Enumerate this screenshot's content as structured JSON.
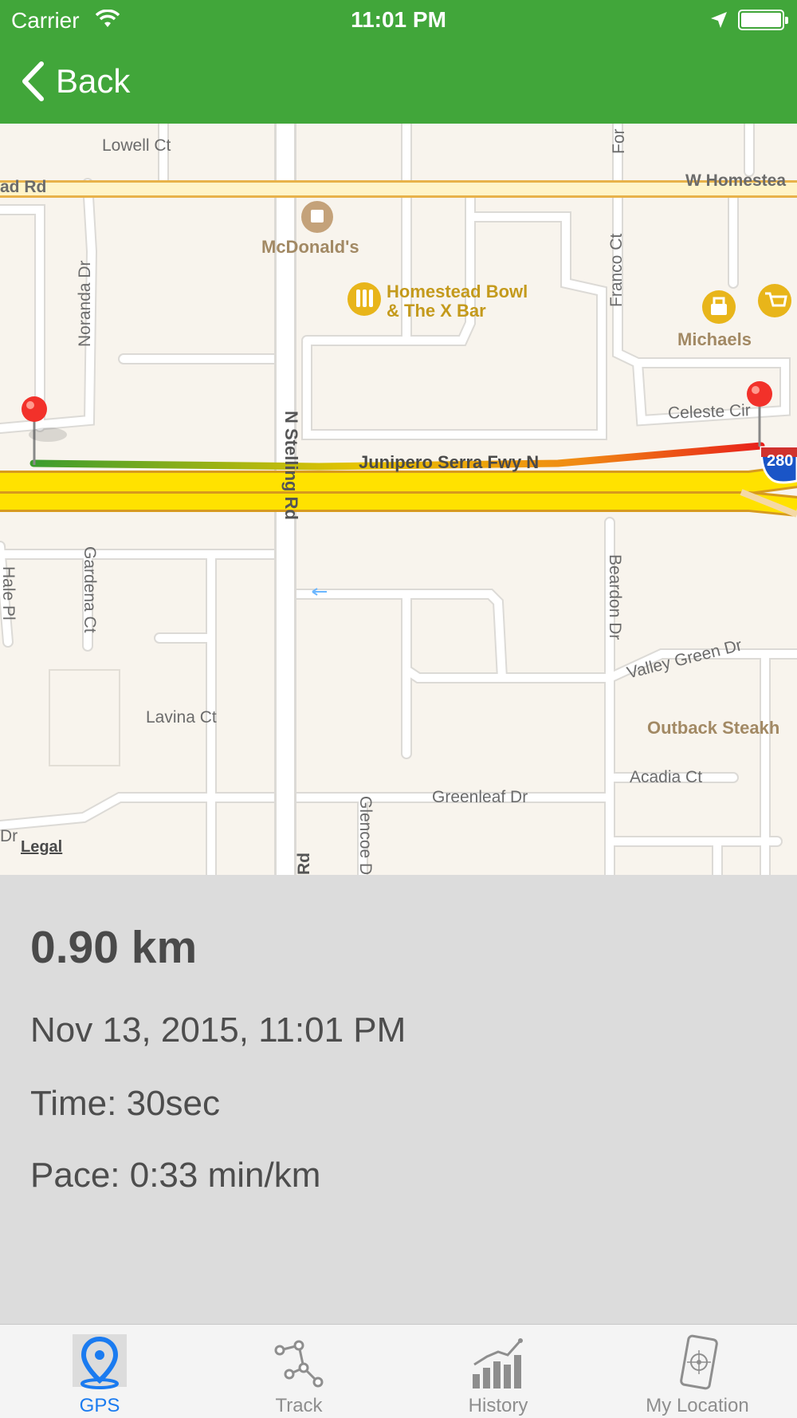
{
  "status_bar": {
    "carrier": "Carrier",
    "time": "11:01 PM"
  },
  "nav": {
    "back_label": "Back"
  },
  "map": {
    "street_labels": {
      "lowell": "Lowell Ct",
      "homestead_left": "ad Rd",
      "homestead_right": "W Homestea",
      "noranda": "Noranda Dr",
      "stelling": "N Stelling Rd",
      "franco": "Franco Ct",
      "celeste": "Celeste Cir",
      "freeway": "Junipero Serra Fwy N",
      "gardena": "Gardena Ct",
      "hale": "Hale Pl",
      "beardon": "Beardon Dr",
      "valley_green": "Valley Green Dr",
      "lavina": "Lavina Ct",
      "acadia": "Acadia Ct",
      "greenleaf": "Greenleaf Dr",
      "glencoe": "Glencoe Dr",
      "rd_bottom": "Rd",
      "dr_left": "Dr",
      "for": "For"
    },
    "pois": {
      "mcdonalds": "McDonald's",
      "homestead_bowl_1": "Homestead Bowl",
      "homestead_bowl_2": "& The X Bar",
      "michaels": "Michaels",
      "outback": "Outback Steakh"
    },
    "highway_shield": "280",
    "legal": "Legal",
    "route_colors": {
      "start": "#3b9c2e",
      "middle": "#e8c400",
      "end": "#e8201a"
    }
  },
  "run": {
    "distance": "0.90 km",
    "datetime": "Nov 13, 2015, 11:01 PM",
    "time": "Time: 30sec",
    "pace": "Pace: 0:33 min/km"
  },
  "tabs": [
    {
      "label": "GPS",
      "icon": "map-pin-icon",
      "active": true
    },
    {
      "label": "Track",
      "icon": "track-icon",
      "active": false
    },
    {
      "label": "History",
      "icon": "bar-chart-icon",
      "active": false
    },
    {
      "label": "My Location",
      "icon": "phone-location-icon",
      "active": false
    }
  ],
  "colors": {
    "header": "#41a63a",
    "panel": "#dcdcdc",
    "tab_active": "#1a7bf0",
    "tab_inactive": "#8e8e8e"
  }
}
